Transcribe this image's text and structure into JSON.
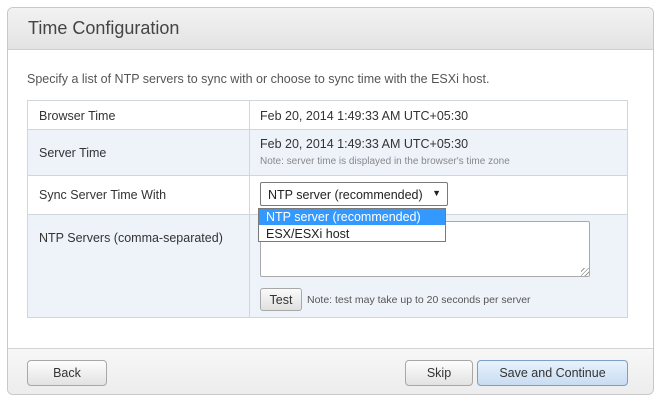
{
  "dialog": {
    "title": "Time Configuration",
    "intro": "Specify a list of NTP servers to sync with or choose to sync time with the ESXi host."
  },
  "rows": {
    "browser_time": {
      "label": "Browser Time",
      "value": "Feb 20, 2014 1:49:33 AM UTC+05:30"
    },
    "server_time": {
      "label": "Server Time",
      "value": "Feb 20, 2014 1:49:33 AM UTC+05:30",
      "note": "Note: server time is displayed in the browser's time zone"
    },
    "sync_with": {
      "label": "Sync Server Time With",
      "selected": "NTP server (recommended)",
      "options": [
        "NTP server (recommended)",
        "ESX/ESXi host"
      ]
    },
    "ntp_servers": {
      "label": "NTP Servers (comma-separated)",
      "value": "",
      "test_label": "Test",
      "test_note": "Note: test may take up to 20 seconds per server"
    }
  },
  "footer": {
    "back_label": "Back",
    "skip_label": "Skip",
    "continue_label": "Save and Continue"
  },
  "colors": {
    "row_alt_bg": "#eef3fa",
    "selected_option_bg": "#3399ff",
    "primary_button_bg": "#c8dcf2"
  },
  "icons": {
    "dropdown": "chevron-down-icon",
    "resize": "resize-grip-icon"
  }
}
